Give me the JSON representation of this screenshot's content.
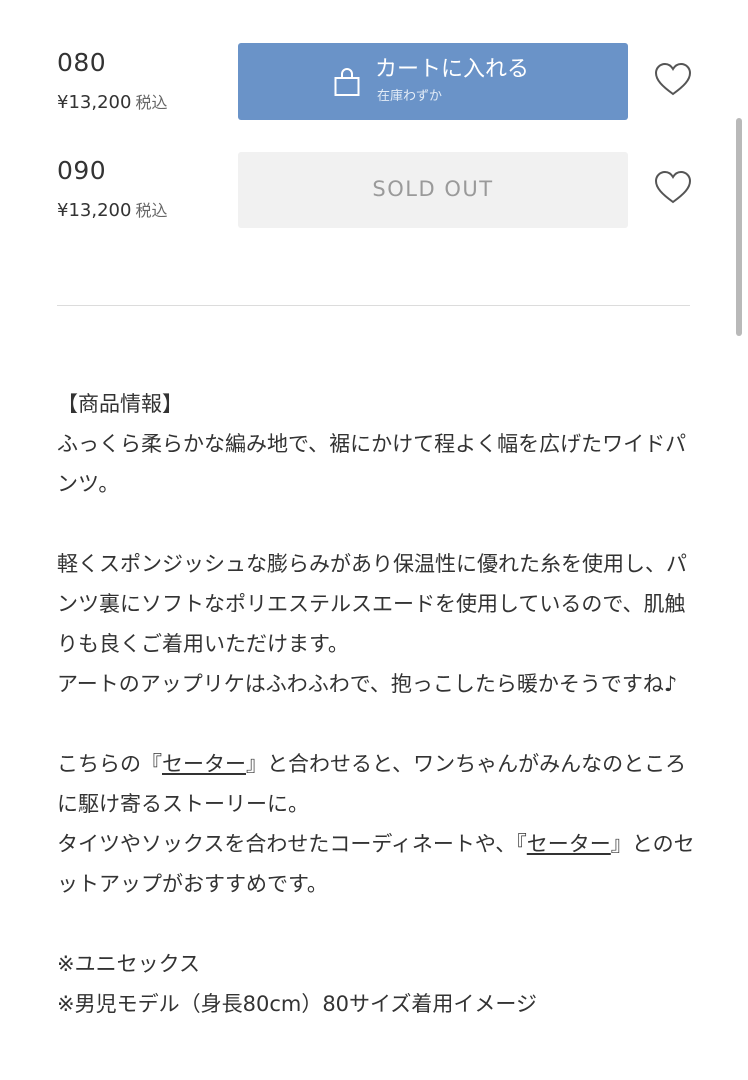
{
  "sizes": [
    {
      "code": "080",
      "price": "¥13,200",
      "tax_label": "税込",
      "button_label": "カートに入れる",
      "stock_label": "在庫わずか"
    },
    {
      "code": "090",
      "price": "¥13,200",
      "tax_label": "税込",
      "button_label": "SOLD OUT"
    }
  ],
  "description": {
    "heading": "【商品情報】",
    "para1": "ふっくら柔らかな編み地で、裾にかけて程よく幅を広げたワイドパンツ。",
    "para2a": "軽くスポンジッシュな膨らみがあり保温性に優れた糸を使用し、パンツ裏にソフトなポリエステルスエードを使用しているので、肌触りも良くご着用いただけます。",
    "para2b": "アートのアップリケはふわふわで、抱っこしたら暖かそうですね♪",
    "para3a_pre": "こちらの『",
    "para3a_link": "セーター",
    "para3a_post": "』と合わせると、ワンちゃんがみんなのところに駆け寄るストーリーに。",
    "para3b_pre": "タイツやソックスを合わせたコーディネートや、『",
    "para3b_link": "セーター",
    "para3b_post": "』とのセットアップがおすすめです。",
    "note1": "※ユニセックス",
    "note2": "※男児モデル（身長80cm）80サイズ着用イメージ"
  },
  "colors": {
    "cart_button": "#6a93c8",
    "soldout_button": "#f1f1f1",
    "soldout_text": "#9a9a9a",
    "text": "#333333"
  },
  "icons": {
    "bag": "shopping-bag-icon",
    "favorite": "heart-outline-icon"
  }
}
